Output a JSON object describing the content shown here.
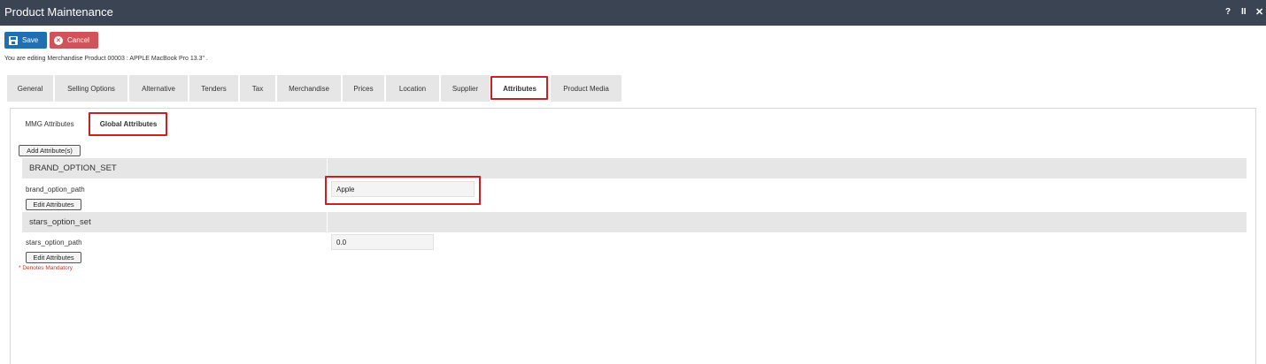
{
  "window": {
    "title": "Product Maintenance",
    "controls": {
      "help": "?",
      "pause": "II",
      "close": "✕"
    }
  },
  "toolbar": {
    "save_label": "Save",
    "cancel_label": "Cancel"
  },
  "editing_note": "You are editing Merchandise Product 00003 : APPLE MacBook Pro 13.3\" .",
  "tabs": [
    {
      "label": "General"
    },
    {
      "label": "Selling Options"
    },
    {
      "label": "Alternative"
    },
    {
      "label": "Tenders"
    },
    {
      "label": "Tax"
    },
    {
      "label": "Merchandise"
    },
    {
      "label": "Prices"
    },
    {
      "label": "Location"
    },
    {
      "label": "Supplier"
    },
    {
      "label": "Attributes"
    },
    {
      "label": "Product Media"
    }
  ],
  "active_tab": "Attributes",
  "subtabs": [
    {
      "label": "MMG Attributes"
    },
    {
      "label": "Global Attributes"
    }
  ],
  "active_subtab": "Global Attributes",
  "add_attributes_label": "Add Attribute(s)",
  "sections": [
    {
      "header": "BRAND_OPTION_SET",
      "field_label": "brand_option_path",
      "field_value": "Apple",
      "edit_label": "Edit Attributes"
    },
    {
      "header": "stars_option_set",
      "field_label": "stars_option_path",
      "field_value": "0.0",
      "edit_label": "Edit Attributes"
    }
  ],
  "mandatory_note": "* Denotes Mandatory",
  "colors": {
    "titlebar": "#3b4453",
    "save": "#1f6fb2",
    "cancel": "#d2525a",
    "highlight": "#cc1f24"
  }
}
